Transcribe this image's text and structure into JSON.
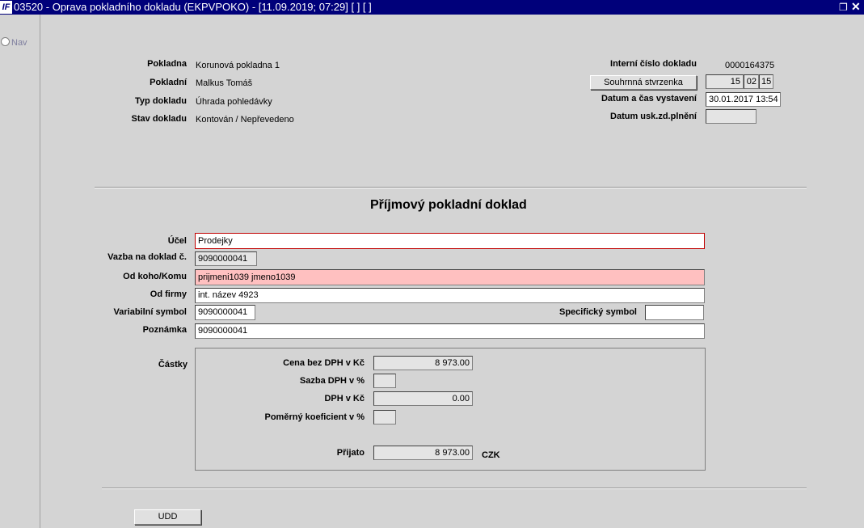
{
  "window": {
    "title": "03520 - Oprava pokladního dokladu (EKPVPOKO) - [11.09.2019; 07:29]  [ ]  [ ]",
    "logo": "IF",
    "restore_glyph": "❐",
    "close_glyph": "✕"
  },
  "sidebar": {
    "nav_label": "Nav"
  },
  "header": {
    "pokladna_label": "Pokladna",
    "pokladna_value": "Korunová pokladna 1",
    "pokladni_label": "Pokladní",
    "pokladni_value": "Malkus Tomáš",
    "typ_label": "Typ dokladu",
    "typ_value": "Úhrada pohledávky",
    "stav_label": "Stav dokladu",
    "stav_value": "Kontován / Nepřevedeno",
    "interni_label": "Interní číslo dokladu",
    "interni_value": "0000164375",
    "souhrnna_button": "Souhrnná stvrzenka",
    "souhrnna_fields": [
      "15",
      "02",
      "15"
    ],
    "datum_cas_label": "Datum a čas vystavení",
    "datum_cas_value": "30.01.2017 13:54",
    "datum_usk_label": "Datum usk.zd.plnění",
    "datum_usk_value": ""
  },
  "form": {
    "heading": "Příjmový pokladní doklad",
    "ucel_label": "Účel",
    "ucel_value": "Prodejky",
    "vazba_label": "Vazba na doklad č.",
    "vazba_value": "9090000041",
    "odkoho_label": "Od koho/Komu",
    "odkoho_value": "prijmeni1039 jmeno1039",
    "odfirmy_label": "Od firmy",
    "odfirmy_value": "int. název 4923",
    "varsym_label": "Variabilní symbol",
    "varsym_value": "9090000041",
    "specsym_label": "Specifický symbol",
    "specsym_value": "",
    "poznamka_label": "Poznámka",
    "poznamka_value": "9090000041"
  },
  "amounts": {
    "group_label": "Částky",
    "cena_label": "Cena bez DPH v Kč",
    "cena_value": "8 973.00",
    "sazba_label": "Sazba DPH v %",
    "sazba_value": "",
    "dph_label": "DPH v Kč",
    "dph_value": "0.00",
    "pomerny_label": "Poměrný koeficient v %",
    "pomerny_value": "",
    "prijato_label": "Přijato",
    "prijato_value": "8 973.00",
    "currency": "CZK"
  },
  "footer": {
    "udd_button": "UDD"
  }
}
